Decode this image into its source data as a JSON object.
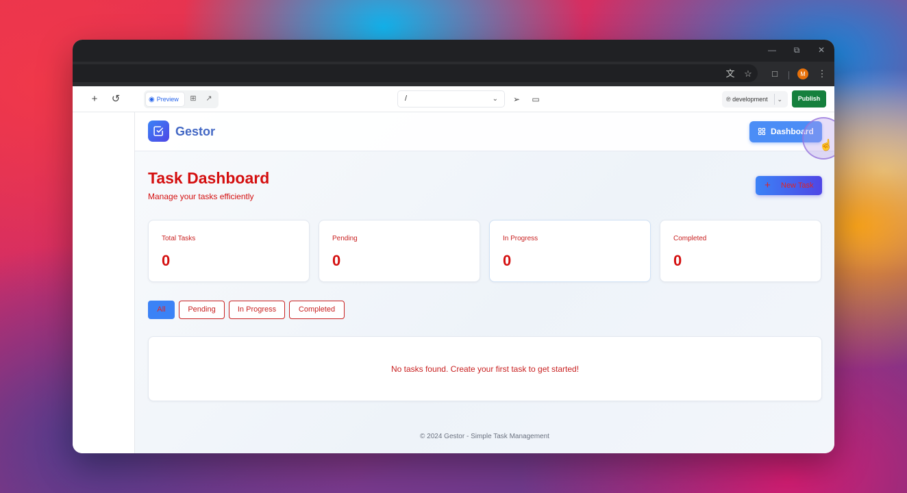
{
  "browser": {
    "window_controls": [
      "minimize",
      "restore",
      "close"
    ],
    "toolbar_icons": [
      "translate-icon",
      "star-icon",
      "extensions-icon"
    ],
    "profile_initial": "M"
  },
  "editor": {
    "preview_label": "Preview",
    "url_path": "/",
    "environment": "development",
    "publish_label": "Publish"
  },
  "app": {
    "brand": "Gestor",
    "dashboard_button": "Dashboard",
    "page_title": "Task Dashboard",
    "page_subtitle": "Manage your tasks efficiently",
    "new_task_button": "New Task",
    "stats": [
      {
        "label": "Total Tasks",
        "value": "0"
      },
      {
        "label": "Pending",
        "value": "0"
      },
      {
        "label": "In Progress",
        "value": "0"
      },
      {
        "label": "Completed",
        "value": "0"
      }
    ],
    "filters": [
      {
        "label": "All",
        "active": true
      },
      {
        "label": "Pending",
        "active": false
      },
      {
        "label": "In Progress",
        "active": false
      },
      {
        "label": "Completed",
        "active": false
      }
    ],
    "empty_message": "No tasks found. Create your first task to get started!",
    "footer": "© 2024 Gestor - Simple Task Management"
  },
  "colors": {
    "accent_blue": "#3b82f6",
    "title_red": "#d40f0f",
    "publish_green": "#15803d"
  }
}
